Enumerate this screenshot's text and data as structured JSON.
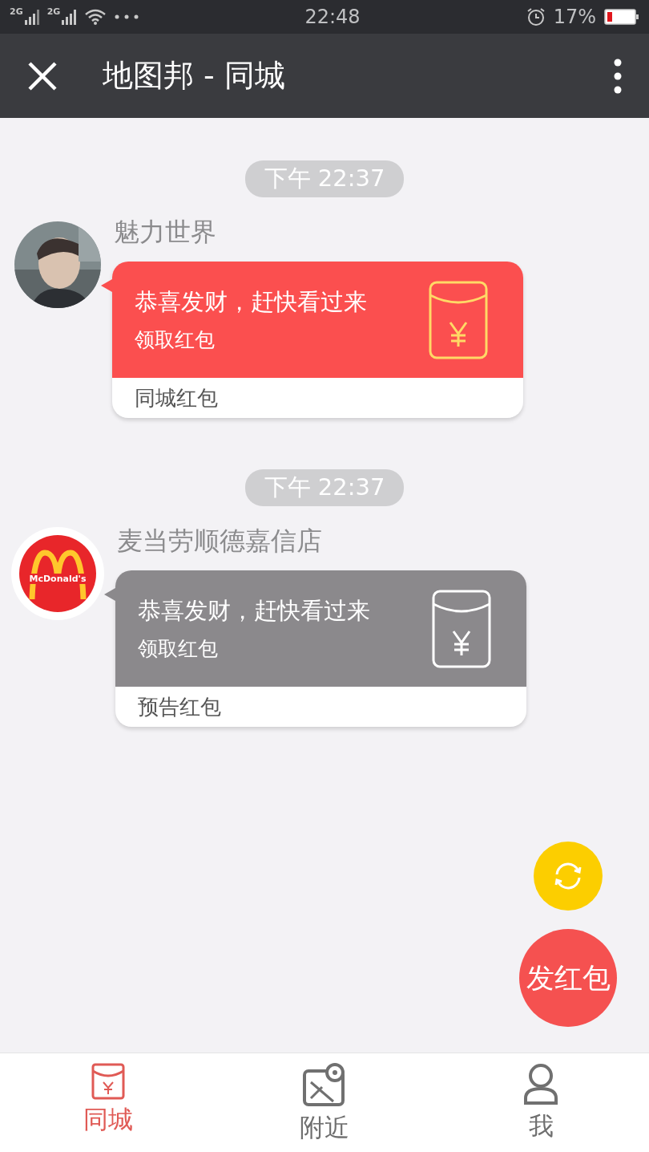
{
  "status_bar": {
    "network_1": "2G",
    "network_2": "2G",
    "time": "22:48",
    "battery": "17%"
  },
  "app_bar": {
    "title": "地图邦 - 同城"
  },
  "messages": [
    {
      "time": "下午 22:37",
      "sender": "魅力世界",
      "color": "#fb4f4f",
      "title": "恭喜发财，赶快看过来",
      "action": "领取红包",
      "footer": "同城红包"
    },
    {
      "time": "下午 22:37",
      "sender": "麦当劳顺德嘉信店",
      "avatar": {
        "kind": "logo",
        "text": "McDonald's"
      },
      "color": "#8b898c",
      "title": "恭喜发财，赶快看过来",
      "action": "领取红包",
      "footer": "预告红包"
    }
  ],
  "send_button": "发红包",
  "tabs": [
    {
      "label": "同城",
      "selected": true,
      "kind": "envelope"
    },
    {
      "label": "附近",
      "selected": false,
      "kind": "map"
    },
    {
      "label": "我",
      "selected": false,
      "kind": "person"
    }
  ]
}
